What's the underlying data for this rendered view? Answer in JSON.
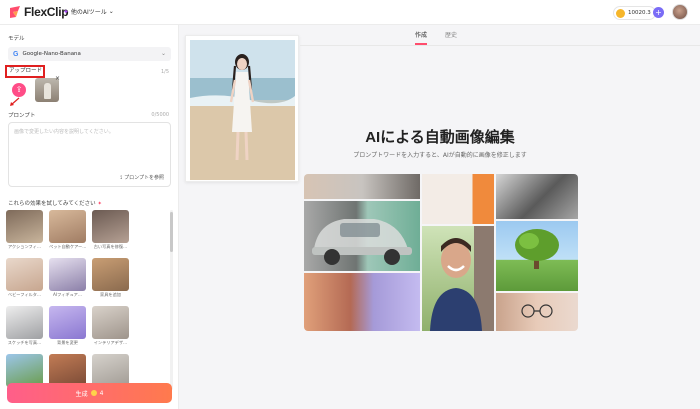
{
  "header": {
    "logo_text": "FlexClip",
    "ai_tools_label": "他のAIツール",
    "credits": "10020.3",
    "plus": "+"
  },
  "sidebar": {
    "model_label": "モデル",
    "model_value": "Google-Nano-Banana",
    "upload_label": "アップロード",
    "upload_count": "1/5",
    "upload_icon": "upload-icon",
    "thumb_close": "×",
    "prompt_label": "プロンプト",
    "prompt_count": "0/5000",
    "prompt_placeholder": "画像で変更したい内容を説明してください。",
    "prompt_library": "プロンプトを参照",
    "effects_title": "これらの効果を試してみてください",
    "effects": [
      {
        "caption": "アクションフィ…",
        "colors": [
          "#7e6a5a",
          "#c9b59c"
        ]
      },
      {
        "caption": "ペット自動ケアー…",
        "colors": [
          "#d8b99b",
          "#a07c63"
        ]
      },
      {
        "caption": "古い写真を修復…",
        "colors": [
          "#6b5a52",
          "#b6a194"
        ]
      },
      {
        "caption": "ベビーフィルタ…",
        "colors": [
          "#e9d8cb",
          "#c7a68f"
        ]
      },
      {
        "caption": "AIフィギュア…",
        "colors": [
          "#e6e0ef",
          "#8b7fa8"
        ]
      },
      {
        "caption": "家具を追加",
        "colors": [
          "#c99e74",
          "#8a6a4e"
        ]
      },
      {
        "caption": "スケッチを写真…",
        "colors": [
          "#eeeeee",
          "#9fa0a3"
        ]
      },
      {
        "caption": "背景を変更",
        "colors": [
          "#c6b7ef",
          "#8a77d1"
        ]
      },
      {
        "caption": "インテリアデザ…",
        "colors": [
          "#d9d2ca",
          "#9e948b"
        ]
      },
      {
        "caption": "",
        "colors": [
          "#9cc6ea",
          "#6a9c4a"
        ]
      },
      {
        "caption": "",
        "colors": [
          "#c27c55",
          "#7a4a36"
        ]
      },
      {
        "caption": "",
        "colors": [
          "#d6d2cc",
          "#a19b94"
        ]
      }
    ],
    "generate_label": "生成",
    "generate_cost": "4"
  },
  "main": {
    "tabs": [
      {
        "label": "作成",
        "active": true
      },
      {
        "label": "歴史",
        "active": false
      }
    ],
    "hero_title": "AIによる自動画像編集",
    "hero_subtitle": "プロンプトワードを入力すると、AIが自動的に画像を修正します"
  },
  "colors": {
    "accent": "#ff4d6d",
    "generate_start": "#ff5e8a",
    "generate_end": "#ff7a4d",
    "upload_button": "#ff4d87"
  }
}
